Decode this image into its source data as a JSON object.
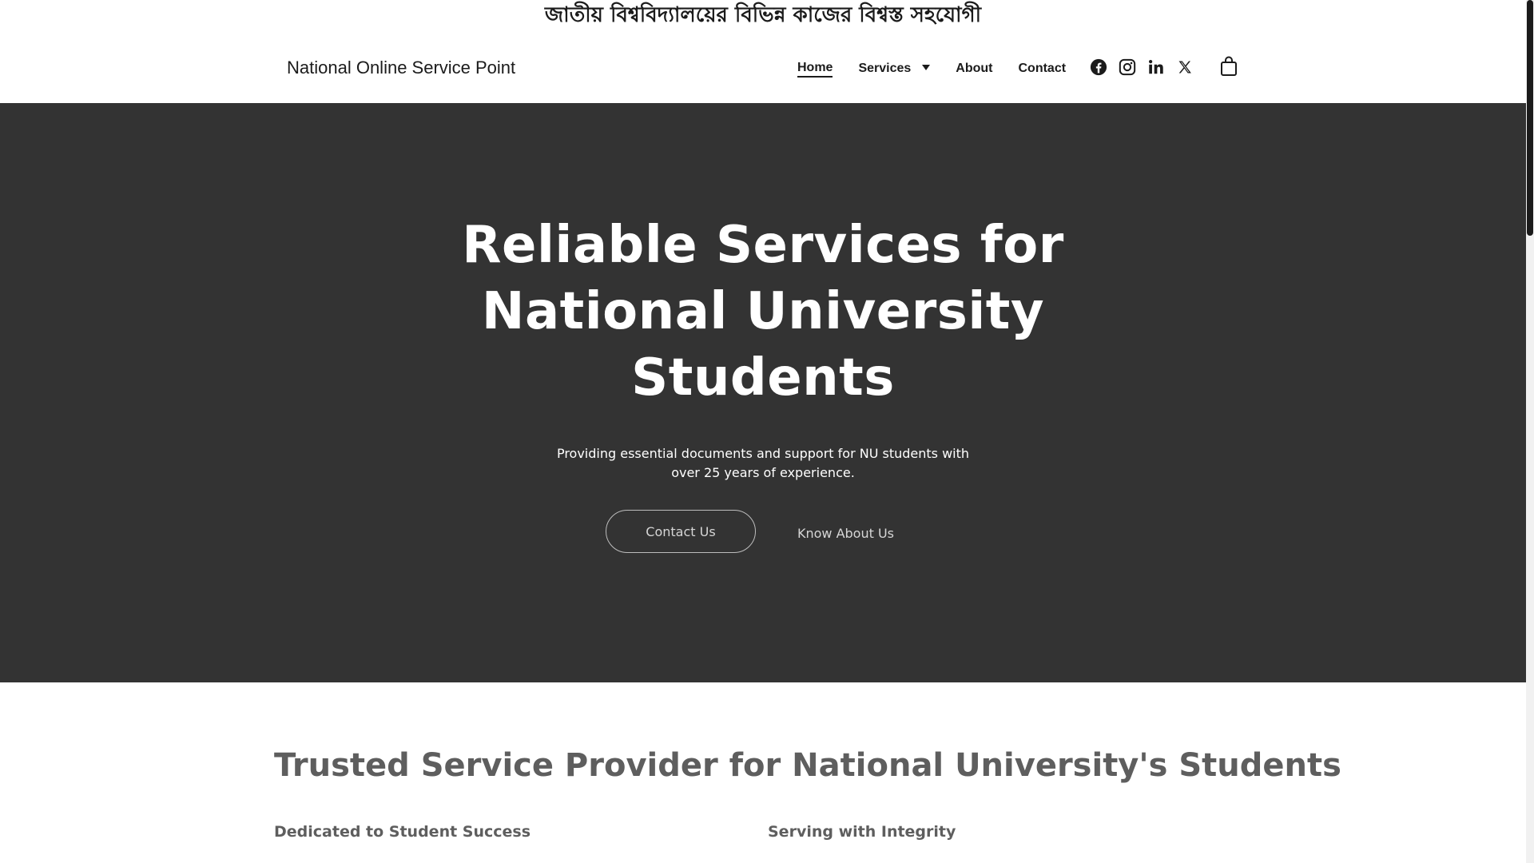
{
  "announcement": {
    "text": "জাতীয় বিশ্ববিদ্যালয়ের বিভিন্ন কাজের বিশ্বস্ত সহযোগী"
  },
  "header": {
    "site_title": "National Online Service Point",
    "nav": {
      "home": "Home",
      "services": "Services",
      "about": "About",
      "contact": "Contact"
    },
    "socials": [
      "facebook-icon",
      "instagram-icon",
      "linkedin-icon",
      "x-icon"
    ],
    "cart_icon": "shopping-bag-icon"
  },
  "hero": {
    "title": "Reliable Services for National University Students",
    "subtitle": "Providing essential documents and support for NU students with over 25 years of experience.",
    "primary_button": "Contact Us",
    "secondary_button": "Know About Us",
    "background_color": "#333333"
  },
  "section": {
    "title": "Trusted Service Provider for National University's Students",
    "features": [
      {
        "heading": "Dedicated to Student Success"
      },
      {
        "heading": "Serving with Integrity"
      }
    ]
  }
}
